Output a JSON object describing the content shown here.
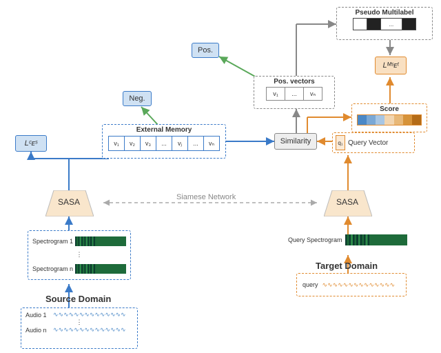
{
  "losses": {
    "l_ce_s": "Lᶜᴇˢ",
    "l_mse_t": "Lᴹˢᴇᵗ"
  },
  "blocks": {
    "external_memory": {
      "title": "External Memory",
      "cells": [
        "v₁",
        "v₂",
        "v₃",
        "...",
        "vⱼ",
        "...",
        "vₙ"
      ]
    },
    "neg": "Neg.",
    "pos": "Pos.",
    "sasa": "SASA",
    "siamese": "Siamese Network",
    "similarity": "Similarity",
    "pos_vectors": {
      "title": "Pos. vectors",
      "cells": [
        "v₁",
        "...",
        "vₙ"
      ]
    },
    "pseudo_multilabel": {
      "title": "Pseudo Multilabel",
      "ellipsis": "..."
    },
    "score": {
      "title": "Score"
    },
    "query_vector": {
      "title": "Query Vector",
      "cell": "q₁"
    }
  },
  "source": {
    "title": "Source Domain",
    "spectrograms": [
      "Spectrogram 1",
      "Spectrogram n"
    ],
    "audios": [
      "Audio 1",
      "Audio n"
    ]
  },
  "target": {
    "title": "Target Domain",
    "spectrogram_label": "Query Spectrogram",
    "audio_label": "query"
  }
}
